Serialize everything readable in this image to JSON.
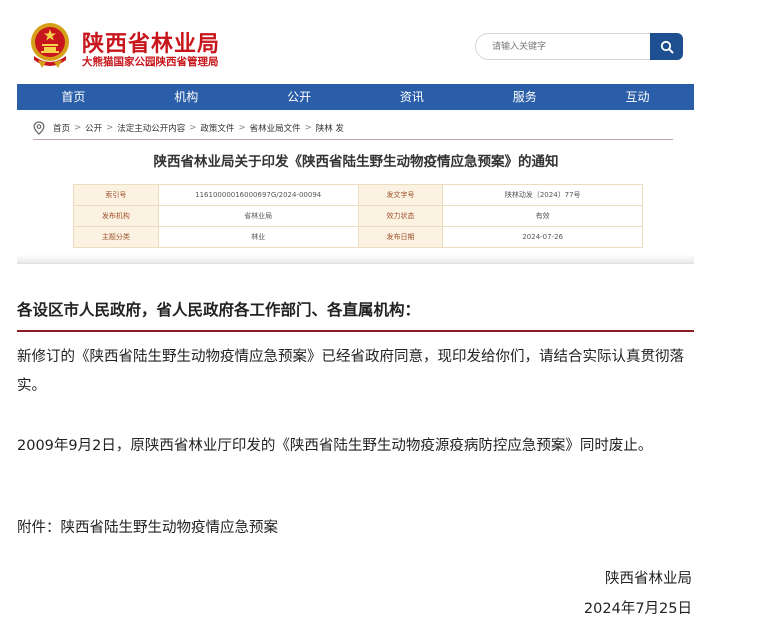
{
  "site": {
    "title": "陕西省林业局",
    "subtitle": "大熊猫国家公园陕西省管理局"
  },
  "search": {
    "placeholder": "请输入关键字"
  },
  "nav": {
    "items": [
      "首页",
      "机构",
      "公开",
      "资讯",
      "服务",
      "互动"
    ]
  },
  "breadcrumb": [
    "首页",
    "公开",
    "法定主动公开内容",
    "政策文件",
    "省林业局文件",
    "陕林 发"
  ],
  "document": {
    "title": "陕西省林业局关于印发《陕西省陆生野生动物疫情应急预案》的通知",
    "meta": [
      {
        "k1": "索引号",
        "v1": "11610000016000697G/2024-00094",
        "k2": "发文字号",
        "v2": "陕林动发〔2024〕77号"
      },
      {
        "k1": "发布机构",
        "v1": "省林业局",
        "k2": "效力状态",
        "v2": "有效"
      },
      {
        "k1": "主题分类",
        "v1": "林业",
        "k2": "发布日期",
        "v2": "2024-07-26"
      }
    ],
    "greeting": "各设区市人民政府，省人民政府各工作部门、各直属机构：",
    "paragraphs": [
      "新修订的《陕西省陆生野生动物疫情应急预案》已经省政府同意，现印发给你们，请结合实际认真贯彻落实。",
      "2009年9月2日，原陕西省林业厅印发的《陕西省陆生野生动物疫源疫病防控应急预案》同时废止。",
      "附件：陕西省陆生野生动物疫情应急预案"
    ],
    "signature": "陕西省林业局",
    "date": "2024年7月25日"
  },
  "colors": {
    "brand_red": "#c8161d",
    "nav_blue": "#2a5ea8",
    "search_blue": "#1d4f91",
    "rule": "#8a1c24"
  },
  "icons": [
    "national-emblem-icon",
    "search-icon",
    "location-pin-icon"
  ]
}
